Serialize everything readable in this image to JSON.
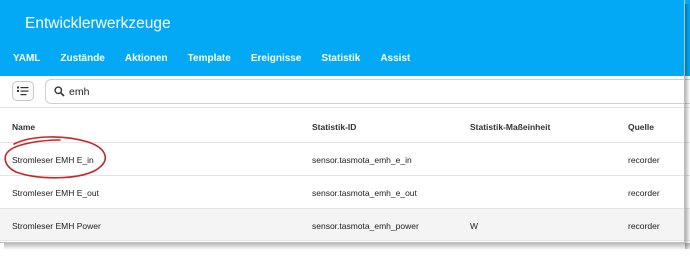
{
  "header": {
    "title": "Entwicklerwerkzeuge",
    "background_color": "#03a9f4"
  },
  "tabs": [
    {
      "label": "YAML"
    },
    {
      "label": "Zustände"
    },
    {
      "label": "Aktionen"
    },
    {
      "label": "Template"
    },
    {
      "label": "Ereignisse"
    },
    {
      "label": "Statistik"
    },
    {
      "label": "Assist"
    }
  ],
  "toolbar": {
    "filter_icon": "filter-list-icon",
    "search_icon": "magnify-icon",
    "search_value": "emh"
  },
  "table": {
    "columns": [
      "Name",
      "Statistik-ID",
      "Statistik-Maßeinheit",
      "Quelle"
    ],
    "rows": [
      {
        "name": "Stromleser EMH E_in",
        "statistic_id": "sensor.tasmota_emh_e_in",
        "unit": "",
        "source": "recorder"
      },
      {
        "name": "Stromleser EMH E_out",
        "statistic_id": "sensor.tasmota_emh_e_out",
        "unit": "",
        "source": "recorder"
      },
      {
        "name": "Stromleser EMH Power",
        "statistic_id": "sensor.tasmota_emh_power",
        "unit": "W",
        "source": "recorder"
      }
    ]
  },
  "annotation": {
    "color": "#c62828"
  }
}
